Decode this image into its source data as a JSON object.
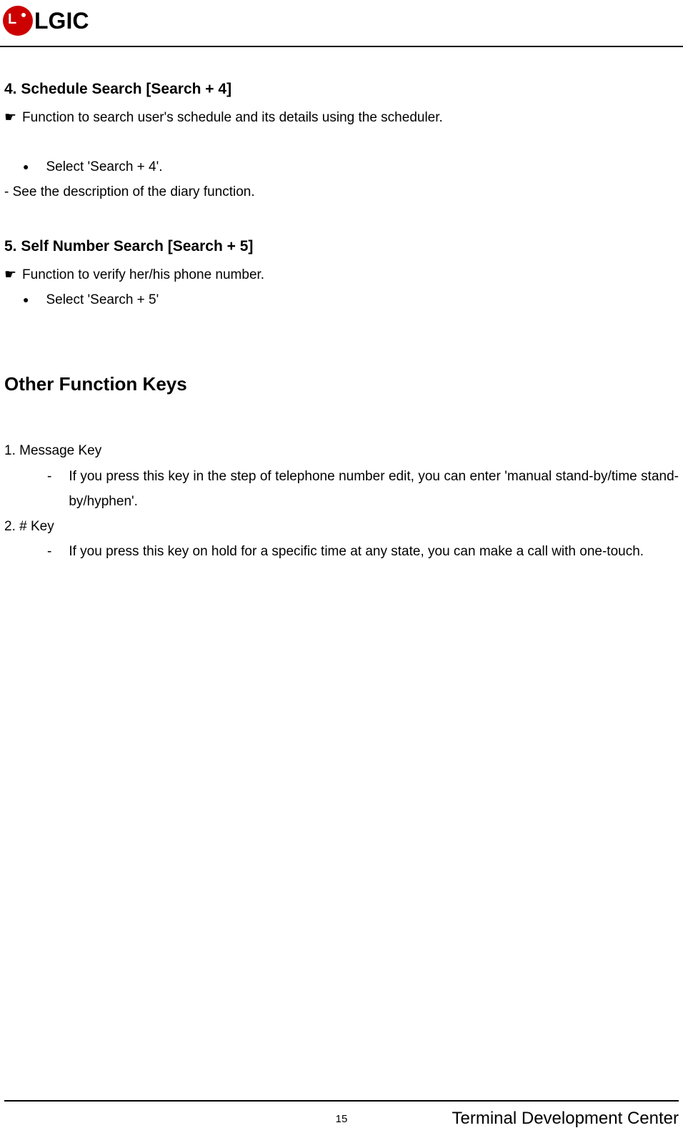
{
  "header": {
    "logo_text": "LGIC"
  },
  "sections": {
    "s4": {
      "heading": "4. Schedule Search [Search + 4]",
      "pointer_text": "Function to search user's schedule and its details using the scheduler.",
      "bullet_text": "Select 'Search + 4'.",
      "dash_text": "- See the description of the diary function."
    },
    "s5": {
      "heading": "5. Self Number Search [Search + 5]",
      "pointer_text": "Function to verify her/his phone number.",
      "bullet_text": "Select 'Search + 5'"
    }
  },
  "main_heading": "Other Function Keys",
  "items": {
    "i1": {
      "label": "1. Message Key",
      "text": "If you press this key in the step of telephone number edit, you can enter 'manual stand-by/time stand-by/hyphen'."
    },
    "i2": {
      "label": "2. # Key",
      "text": "If you press this key on hold for a specific time at any state, you can make a call with one-touch."
    }
  },
  "footer": {
    "page": "15",
    "text": "Terminal Development Center"
  }
}
